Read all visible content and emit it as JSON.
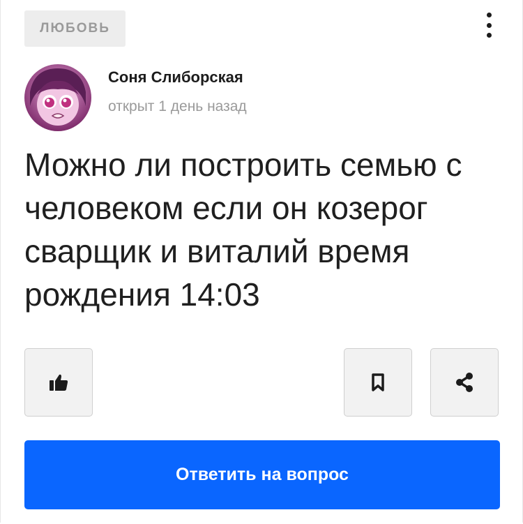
{
  "post": {
    "tag": "ЛЮБОВЬ",
    "author_name": "Соня Слиборская",
    "opened_time": "открыт 1 день назад",
    "question": "Можно ли построить семью с человеком если он козерог сварщик и виталий время рождения 14:03"
  },
  "actions": {
    "like_icon": "thumbs-up-icon",
    "bookmark_icon": "bookmark-icon",
    "share_icon": "share-icon",
    "menu_icon": "more-vertical-icon",
    "answer_label": "Ответить на вопрос"
  },
  "colors": {
    "accent": "#0a66ff",
    "tag_bg": "#ededed",
    "muted_text": "#9a9a9a"
  }
}
